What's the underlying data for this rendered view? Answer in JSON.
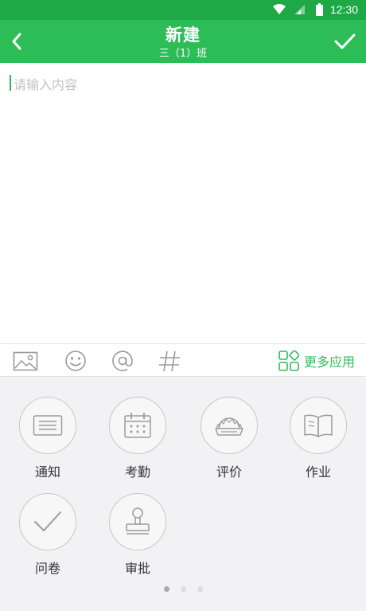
{
  "status_bar": {
    "time": "12:30"
  },
  "header": {
    "title": "新建",
    "subtitle": "三（1）班"
  },
  "editor": {
    "placeholder": "请输入内容"
  },
  "toolbar": {
    "more_label": "更多应用"
  },
  "apps": [
    {
      "label": "通知",
      "icon": "notice-icon"
    },
    {
      "label": "考勤",
      "icon": "attendance-icon"
    },
    {
      "label": "评价",
      "icon": "evaluation-icon"
    },
    {
      "label": "作业",
      "icon": "homework-icon"
    },
    {
      "label": "问卷",
      "icon": "questionnaire-icon"
    },
    {
      "label": "审批",
      "icon": "approval-icon"
    }
  ],
  "pager": {
    "pages": 3,
    "current": 1
  },
  "colors": {
    "status_bar": "#1fa846",
    "header": "#2dbd57",
    "accent": "#2dbd57",
    "panel": "#f2f2f4"
  }
}
